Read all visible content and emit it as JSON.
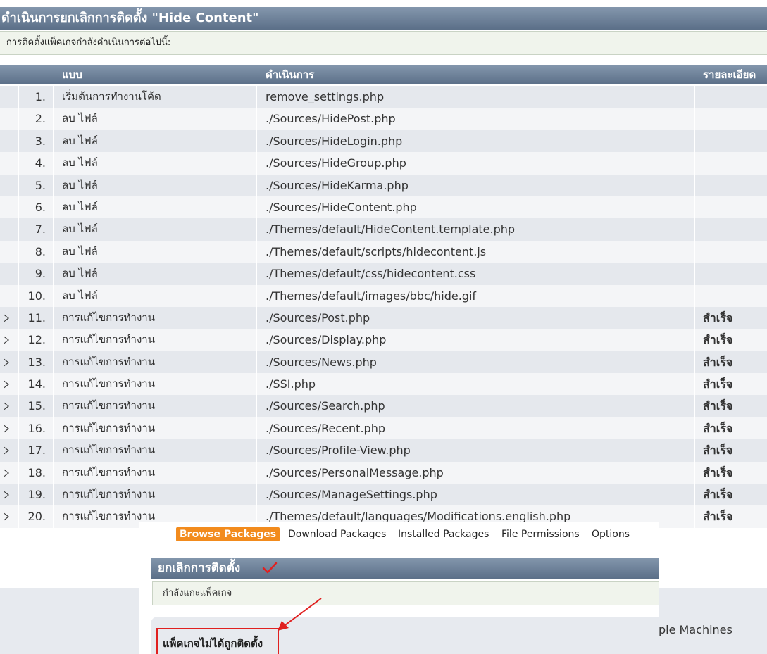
{
  "title": "ดำเนินการยกเลิกการติดตั้ง \"Hide Content\"",
  "info": "การติดตั้งแพ็คเกจกำลังดำเนินการต่อไปนี้:",
  "table": {
    "headers": {
      "type": "แบบ",
      "action": "ดำเนินการ",
      "details": "รายละเอียด"
    },
    "rows": [
      {
        "num": "1.",
        "type": "เริ่มต้นการทำงานโค้ด",
        "action": "remove_settings.php",
        "details": "",
        "expandable": false
      },
      {
        "num": "2.",
        "type": "ลบ ไฟล์",
        "action": "./Sources/HidePost.php",
        "details": "",
        "expandable": false
      },
      {
        "num": "3.",
        "type": "ลบ ไฟล์",
        "action": "./Sources/HideLogin.php",
        "details": "",
        "expandable": false
      },
      {
        "num": "4.",
        "type": "ลบ ไฟล์",
        "action": "./Sources/HideGroup.php",
        "details": "",
        "expandable": false
      },
      {
        "num": "5.",
        "type": "ลบ ไฟล์",
        "action": "./Sources/HideKarma.php",
        "details": "",
        "expandable": false
      },
      {
        "num": "6.",
        "type": "ลบ ไฟล์",
        "action": "./Sources/HideContent.php",
        "details": "",
        "expandable": false
      },
      {
        "num": "7.",
        "type": "ลบ ไฟล์",
        "action": "./Themes/default/HideContent.template.php",
        "details": "",
        "expandable": false
      },
      {
        "num": "8.",
        "type": "ลบ ไฟล์",
        "action": "./Themes/default/scripts/hidecontent.js",
        "details": "",
        "expandable": false
      },
      {
        "num": "9.",
        "type": "ลบ ไฟล์",
        "action": "./Themes/default/css/hidecontent.css",
        "details": "",
        "expandable": false
      },
      {
        "num": "10.",
        "type": "ลบ ไฟล์",
        "action": "./Themes/default/images/bbc/hide.gif",
        "details": "",
        "expandable": false
      },
      {
        "num": "11.",
        "type": "การแก้ไขการทำงาน",
        "action": "./Sources/Post.php",
        "details": "สำเร็จ",
        "expandable": true
      },
      {
        "num": "12.",
        "type": "การแก้ไขการทำงาน",
        "action": "./Sources/Display.php",
        "details": "สำเร็จ",
        "expandable": true
      },
      {
        "num": "13.",
        "type": "การแก้ไขการทำงาน",
        "action": "./Sources/News.php",
        "details": "สำเร็จ",
        "expandable": true
      },
      {
        "num": "14.",
        "type": "การแก้ไขการทำงาน",
        "action": "./SSI.php",
        "details": "สำเร็จ",
        "expandable": true
      },
      {
        "num": "15.",
        "type": "การแก้ไขการทำงาน",
        "action": "./Sources/Search.php",
        "details": "สำเร็จ",
        "expandable": true
      },
      {
        "num": "16.",
        "type": "การแก้ไขการทำงาน",
        "action": "./Sources/Recent.php",
        "details": "สำเร็จ",
        "expandable": true
      },
      {
        "num": "17.",
        "type": "การแก้ไขการทำงาน",
        "action": "./Sources/Profile-View.php",
        "details": "สำเร็จ",
        "expandable": true
      },
      {
        "num": "18.",
        "type": "การแก้ไขการทำงาน",
        "action": "./Sources/PersonalMessage.php",
        "details": "สำเร็จ",
        "expandable": true
      },
      {
        "num": "19.",
        "type": "การแก้ไขการทำงาน",
        "action": "./Sources/ManageSettings.php",
        "details": "สำเร็จ",
        "expandable": true
      },
      {
        "num": "20.",
        "type": "การแก้ไขการทำงาน",
        "action": "./Themes/default/languages/Modifications.english.php",
        "details": "สำเร็จ",
        "expandable": true
      }
    ]
  },
  "footer_text": "ple Machines",
  "overlay": {
    "menu": [
      "Browse Packages",
      "Download Packages",
      "Installed Packages",
      "File Permissions",
      "Options"
    ],
    "active_menu": "Browse Packages",
    "title": "ยกเลิกการติดตั้ง",
    "info": "กำลังแกะแพ็คเกจ",
    "result": "แพ็คเกจไม่ได้ถูกติดตั้ง"
  },
  "colors": {
    "header_gradient_top": "#8497ad",
    "header_gradient_bottom": "#5b6f88",
    "active_menu": "#f28b1d",
    "annotation": "#e02020"
  }
}
